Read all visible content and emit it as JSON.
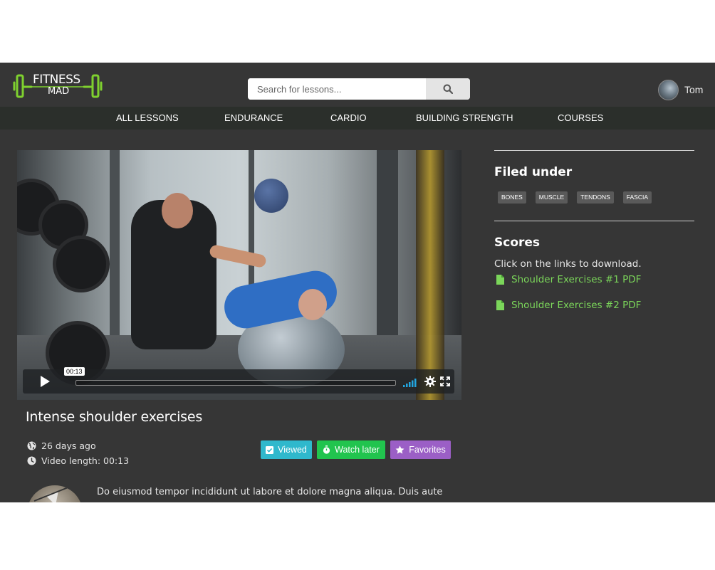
{
  "brand": {
    "line1": "FITNESS",
    "line2": "MAD",
    "accent": "#7fd12f"
  },
  "search": {
    "placeholder": "Search for lessons..."
  },
  "user": {
    "name": "Tom"
  },
  "nav": {
    "items": [
      {
        "label": "ALL LESSONS"
      },
      {
        "label": "ENDURANCE"
      },
      {
        "label": "CARDIO"
      },
      {
        "label": "BUILDING STRENGTH"
      },
      {
        "label": "COURSES"
      }
    ]
  },
  "player": {
    "current_time": "00:13",
    "progress": 0.0,
    "icons": [
      "play-icon",
      "volume-icon",
      "gear-icon",
      "fullscreen-icon"
    ]
  },
  "lesson": {
    "title": "Intense shoulder exercises",
    "posted": "26 days ago",
    "length": "Video length: 00:13"
  },
  "actions": {
    "viewed": {
      "label": "Viewed",
      "color": "#2fb8cc"
    },
    "watch_later": {
      "label": "Watch later",
      "color": "#21c44e"
    },
    "favorites": {
      "label": "Favorites",
      "color": "#9b5fc6"
    }
  },
  "comment": {
    "text": "Do eiusmod tempor incididunt ut labore et dolore magna aliqua. Duis aute"
  },
  "filed_under": {
    "title": "Filed under",
    "tags": [
      "BONES",
      "MUSCLE",
      "TENDONS",
      "FASCIA"
    ]
  },
  "scores": {
    "title": "Scores",
    "description": "Click on the links to download.",
    "links": [
      {
        "label": "Shoulder Exercises #1 PDF"
      },
      {
        "label": "Shoulder Exercises #2 PDF"
      }
    ],
    "link_color": "#7bd65a"
  }
}
